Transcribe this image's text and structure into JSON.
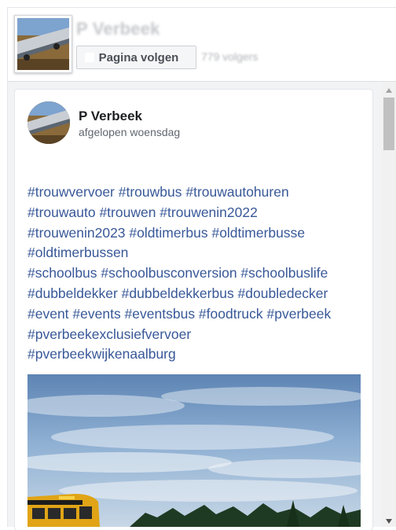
{
  "page": {
    "name": "P Verbeek",
    "follow_label": "Pagina volgen",
    "followers": "779 volgers"
  },
  "post": {
    "author": "P Verbeek",
    "time": "afgelopen woensdag",
    "hashtag_lines": [
      "#trouwvervoer #trouwbus #trouwautohuren",
      "#trouwauto #trouwen #trouwenin2022",
      "#trouwenin2023 #oldtimerbus #oldtimerbusse",
      "#oldtimerbussen",
      "#schoolbus #schoolbusconversion #schoolbuslife",
      "#dubbeldekker #dubbeldekkerbus #doubledecker",
      "#event #events #eventsbus #foodtruck #pverbeek",
      "#pverbeekexclusiefvervoer",
      "#pverbeekwijkenaalburg"
    ]
  },
  "colors": {
    "link": "#385898",
    "author": "#1c1e21",
    "muted": "#606770"
  },
  "icons": {
    "follow": "facebook-f-icon",
    "scroll_up": "triangle-up-icon",
    "scroll_down": "triangle-down-icon"
  }
}
